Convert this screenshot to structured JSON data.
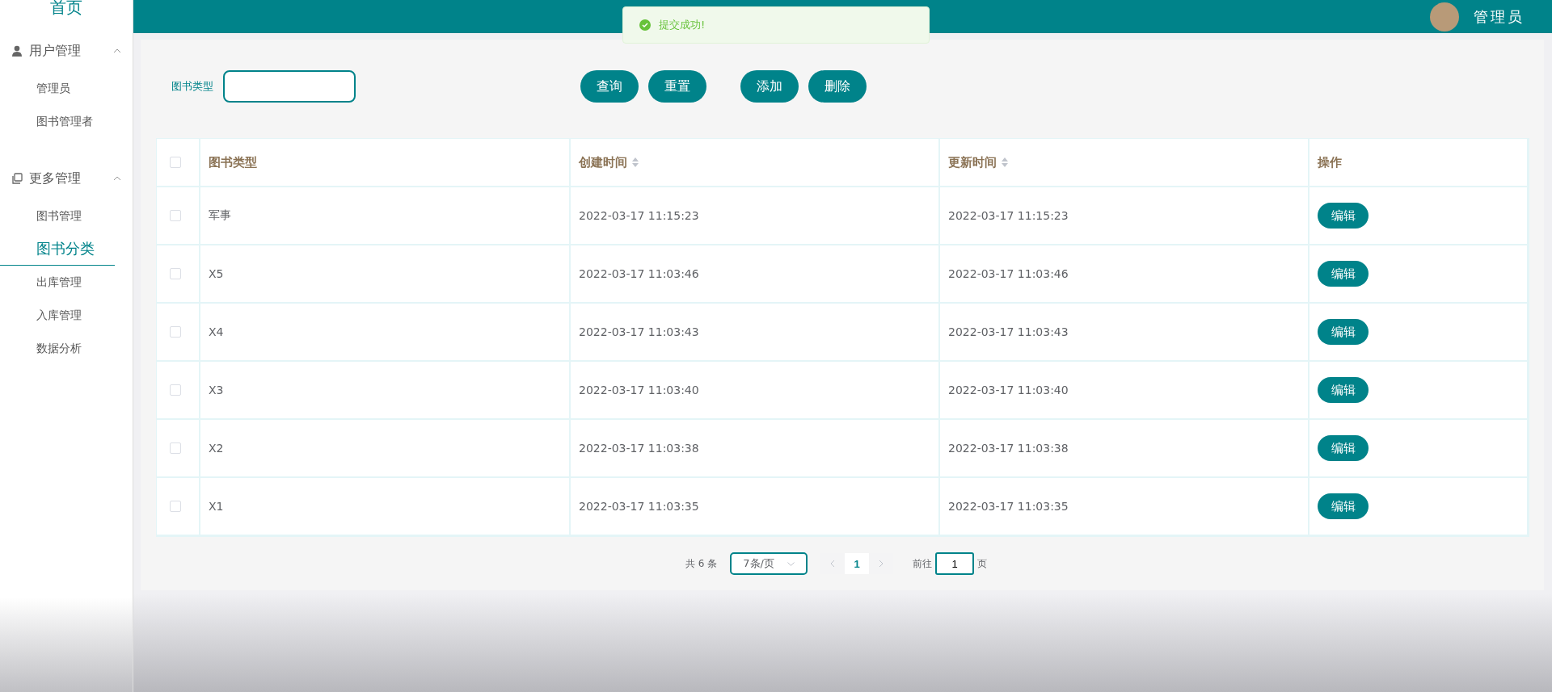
{
  "sidebar": {
    "home": "首页",
    "groups": [
      {
        "kind": "user",
        "label": "用户管理",
        "expanded": true,
        "items": [
          {
            "label": "管理员",
            "selected": false
          },
          {
            "label": "图书管理者",
            "selected": false
          }
        ]
      },
      {
        "kind": "copy",
        "label": "更多管理",
        "expanded": true,
        "items": [
          {
            "label": "图书管理",
            "selected": false
          },
          {
            "label": "图书分类",
            "selected": true
          },
          {
            "label": "出库管理",
            "selected": false
          },
          {
            "label": "入库管理",
            "selected": false
          },
          {
            "label": "数据分析",
            "selected": false
          }
        ]
      }
    ]
  },
  "header": {
    "user": "管理员"
  },
  "toast": {
    "message": "提交成功!"
  },
  "filter": {
    "label": "图书类型",
    "buttons": [
      "查询",
      "重置",
      "添加",
      "删除"
    ]
  },
  "table": {
    "all_checked": false,
    "columns": [
      {
        "label": "图书类型",
        "sortable": false
      },
      {
        "label": "创建时间",
        "sortable": true
      },
      {
        "label": "更新时间",
        "sortable": true
      },
      {
        "label": "操作",
        "sortable": false
      }
    ],
    "rows": [
      {
        "checked": false,
        "cells": [
          "军事",
          "2022-03-17 11:15:23",
          "2022-03-17 11:15:23"
        ],
        "action": "编辑"
      },
      {
        "checked": false,
        "cells": [
          "X5",
          "2022-03-17 11:03:46",
          "2022-03-17 11:03:46"
        ],
        "action": "编辑"
      },
      {
        "checked": false,
        "cells": [
          "X4",
          "2022-03-17 11:03:43",
          "2022-03-17 11:03:43"
        ],
        "action": "编辑"
      },
      {
        "checked": false,
        "cells": [
          "X3",
          "2022-03-17 11:03:40",
          "2022-03-17 11:03:40"
        ],
        "action": "编辑"
      },
      {
        "checked": false,
        "cells": [
          "X2",
          "2022-03-17 11:03:38",
          "2022-03-17 11:03:38"
        ],
        "action": "编辑"
      },
      {
        "checked": false,
        "cells": [
          "X1",
          "2022-03-17 11:03:35",
          "2022-03-17 11:03:35"
        ],
        "action": "编辑"
      }
    ]
  },
  "pagination": {
    "total": "共 6 条",
    "page_size": "7条/页",
    "pages": [
      {
        "label": "1",
        "selected": true
      }
    ],
    "goto_label": "前往",
    "goto_value": "1",
    "goto_suffix": "页"
  }
}
